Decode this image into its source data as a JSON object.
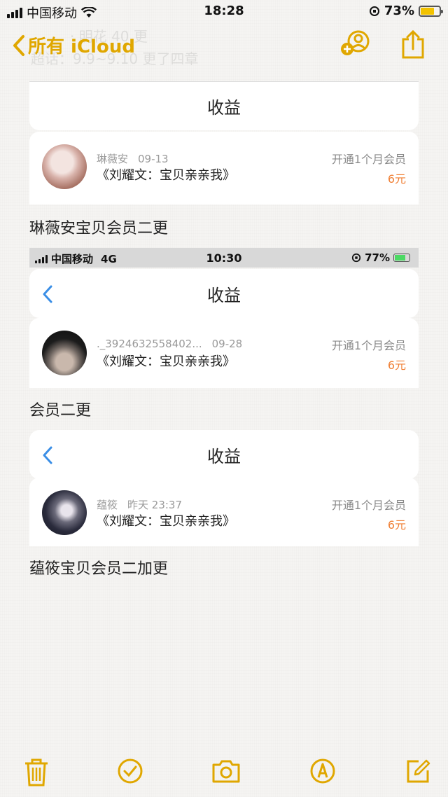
{
  "status_bar": {
    "carrier": "中国移动",
    "time": "18:28",
    "battery": "73%"
  },
  "nav": {
    "back_label": "所有 iCloud",
    "ghost_line1": "· 明花 40 更",
    "ghost_line2": "超话：9.9~9.10 更了四章"
  },
  "accent_color": "#e0a700",
  "blocks": [
    {
      "header": "收益",
      "user": "琳薇安",
      "date": "09-13",
      "book": "《刘耀文：宝贝亲亲我》",
      "vip": "开通1个月会员",
      "price": "6元",
      "caption": "琳薇安宝贝会员二更"
    },
    {
      "inner_status": {
        "carrier": "中国移动",
        "network": "4G",
        "time": "10:30",
        "battery": "77%"
      },
      "header": "收益",
      "user": "._3924632558402...",
      "date": "09-28",
      "book": "《刘耀文：宝贝亲亲我》",
      "vip": "开通1个月会员",
      "price": "6元",
      "caption": "会员二更"
    },
    {
      "header": "收益",
      "user": "蕴筱",
      "date": "昨天 23:37",
      "book": "《刘耀文：宝贝亲亲我》",
      "vip": "开通1个月会员",
      "price": "6元",
      "caption": "蕴筱宝贝会员二加更"
    }
  ],
  "toolbar": [
    "trash-icon",
    "checklist-icon",
    "camera-icon",
    "markup-icon",
    "compose-icon"
  ]
}
